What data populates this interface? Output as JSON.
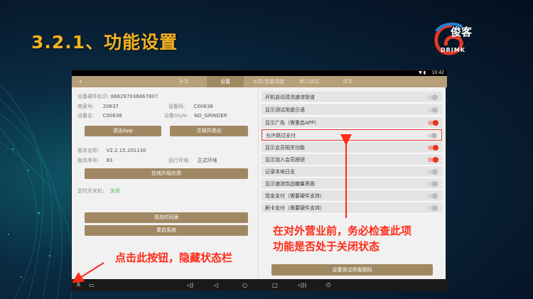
{
  "slide": {
    "title": "3.2.1、功能设置",
    "logo_text": "俊客",
    "logo_sub": "DRIMK"
  },
  "statusbar": {
    "time": "10:42"
  },
  "tabs": [
    {
      "label": "补货",
      "active": false
    },
    {
      "label": "设置",
      "active": true
    },
    {
      "label": "水泵/音量调整",
      "active": false
    },
    {
      "label": "串口测试",
      "active": false
    },
    {
      "label": "货币",
      "active": false
    }
  ],
  "device_info": {
    "hw_id_label": "设备硬件标识:",
    "hw_id": "866297036867807",
    "merchant_label": "商家号:",
    "merchant": "20637",
    "device_code_label": "设备码:",
    "device_code": "C00638",
    "device_name_label": "设备名:",
    "device_name": "C00638",
    "device_style_label": "设备Style:",
    "device_style": "NO_GRINDER"
  },
  "buttons": {
    "exit_app": "退出App",
    "logout_exit": "注销并退出",
    "online_upgrade": "在线升级应用",
    "clear_time_table": "清洗时间表",
    "restart": "重启系统",
    "set_test_password": "设置测试界面密码"
  },
  "version_info": {
    "version_name_label": "版本名称:",
    "version_name": "V2.2.15.201130",
    "version_code_label": "版本序号:",
    "version_code": "83",
    "env_label": "运行环境:",
    "env": "正式环境"
  },
  "timer_switch": {
    "label": "定时开关机:",
    "value": "关闭"
  },
  "settings": [
    {
      "label": "开机自动清洗速溶管道",
      "on": false,
      "highlight": false
    },
    {
      "label": "显示测试用提示语",
      "on": false,
      "highlight": false
    },
    {
      "label": "显示广告（需重启APP）",
      "on": true,
      "highlight": false
    },
    {
      "label": "允许跳过支付",
      "on": false,
      "highlight": true
    },
    {
      "label": "显示会员相关功能",
      "on": true,
      "highlight": false
    },
    {
      "label": "显示加入会员按钮",
      "on": true,
      "highlight": false
    },
    {
      "label": "记录本地日志",
      "on": false,
      "highlight": false
    },
    {
      "label": "显示速溶饮品糖量界面",
      "on": false,
      "highlight": false
    },
    {
      "label": "现金支付（需要硬件支持）",
      "on": false,
      "highlight": false
    },
    {
      "label": "刷卡支付（需要硬件支持）",
      "on": false,
      "highlight": false
    }
  ],
  "callouts": {
    "left": "点击此按钮，隐藏状态栏",
    "right_line1": "在对外营业前，务必检查此项",
    "right_line2": "功能是否处于关闭状态"
  },
  "colors": {
    "title": "#f5b21d",
    "accent": "#a08863",
    "callout": "#ff2a18",
    "toggle_on": "#e8321e"
  },
  "icons": [
    "back-icon",
    "hide-bar-icon",
    "screenshot-icon",
    "volume-down-icon",
    "nav-back-icon",
    "nav-home-icon",
    "nav-recent-icon",
    "volume-up-icon",
    "power-icon"
  ]
}
